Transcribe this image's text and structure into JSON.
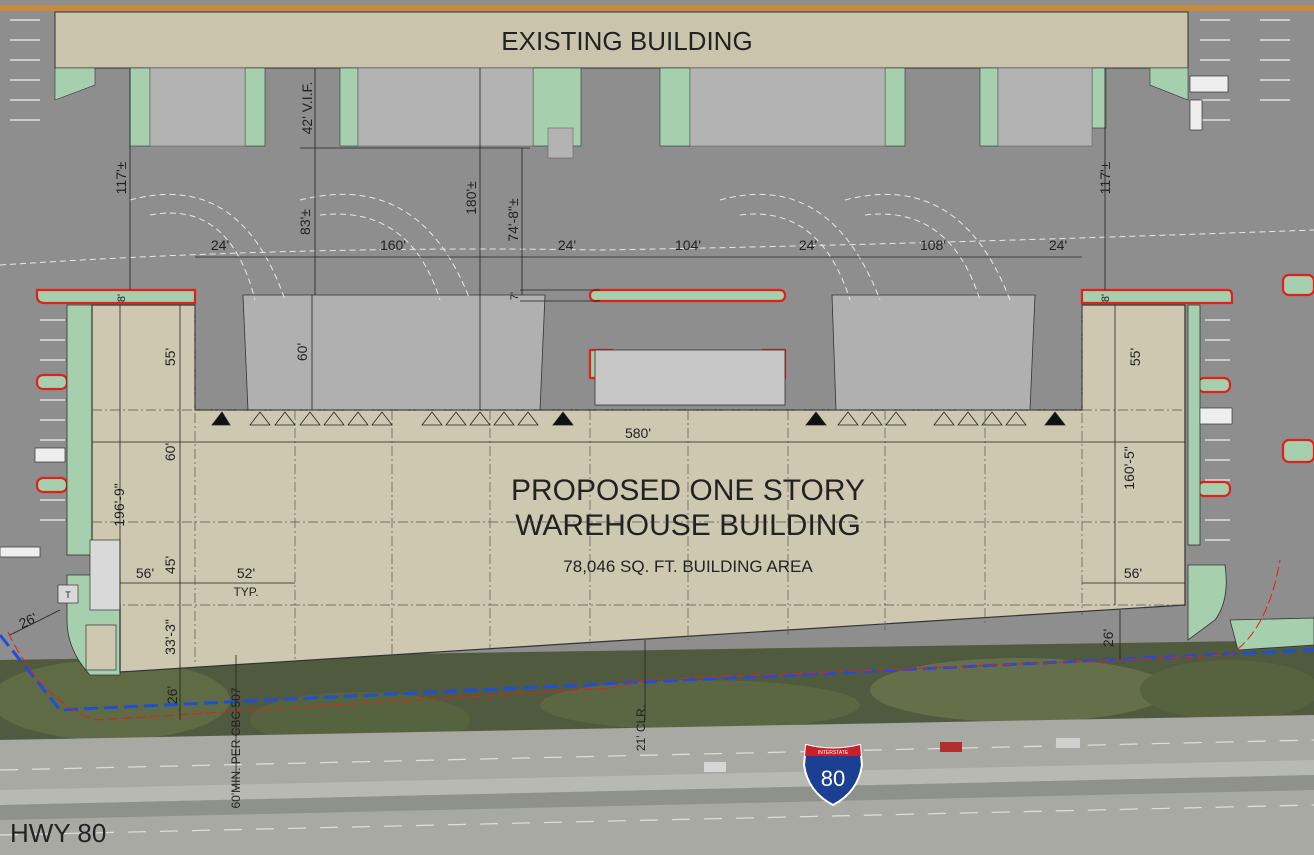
{
  "existing_building": {
    "label": "EXISTING BUILDING"
  },
  "proposed_building": {
    "title_line1": "PROPOSED ONE STORY",
    "title_line2": "WAREHOUSE BUILDING",
    "area": "78,046 SQ. FT. BUILDING AREA"
  },
  "highway": {
    "label": "HWY 80",
    "shield_top": "INTERSTATE",
    "shield_number": "80"
  },
  "dimensions": {
    "d_117_left": "117'±",
    "d_117_right": "117'±",
    "d_42_vif": "42' V.I.F.",
    "d_83": "83'±",
    "d_180": "180'±",
    "d_74_8": "74'-8\"±",
    "d_24_a": "24'",
    "d_160": "160'",
    "d_24_b": "24'",
    "d_104": "104'",
    "d_24_c": "24'",
    "d_108": "108'",
    "d_24_d": "24'",
    "d_8_left": "8'",
    "d_8_right": "8'",
    "d_7": "7'",
    "d_55_left": "55'",
    "d_55_right": "55'",
    "d_60_dock": "60'",
    "d_60_bay": "60'",
    "d_580": "580'",
    "d_196_9": "196'-9\"",
    "d_160_5": "160'-5\"",
    "d_45": "45'",
    "d_56_left": "56'",
    "d_56_right": "56'",
    "d_52": "52'",
    "d_typ": "TYP.",
    "d_33_3": "33'-3\"",
    "d_26_left": "26'",
    "d_26_bottom": "26'",
    "d_26_right": "26'",
    "d_21_clr": "21' CLR.",
    "d_60_min": "60'MIN. PER CBC 507"
  },
  "small_labels": {
    "transformer": "T"
  },
  "colors": {
    "pavement": "#8f8f8f",
    "landscape": "#a6cfae",
    "building_fill": "#cfc8b0",
    "existing_fill": "#cbc4ad",
    "curb_red": "#e0201a",
    "property_blue": "#1f4fd8",
    "shield_blue": "#1b3f93",
    "shield_red": "#c8202a"
  }
}
